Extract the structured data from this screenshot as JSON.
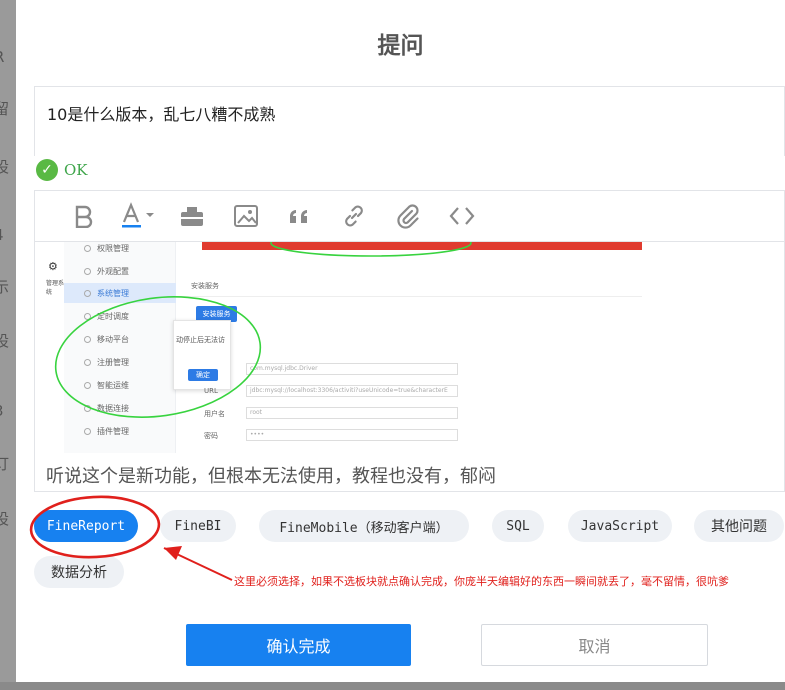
{
  "dialog": {
    "title": "提问",
    "question_text": "10是什么版本，乱七八糟不成熟",
    "ok_label": "OK",
    "toolbar": {
      "icons": [
        "bold-icon",
        "font-color-icon",
        "code-block-icon",
        "image-icon",
        "quote-icon",
        "link-icon",
        "attachment-icon",
        "code-icon"
      ]
    },
    "embedded_screenshot": {
      "sidebar_items": [
        "权限管理",
        "外观配置",
        "系统管理",
        "定时调度",
        "移动平台",
        "注册管理",
        "智能运维",
        "数据连接",
        "插件管理"
      ],
      "active_item": "系统管理",
      "system_label": "管理系统",
      "section_label": "安装服务",
      "install_button": "安装服务",
      "popup_text": "动停止后无法访",
      "popup_confirm": "确定",
      "driver_value": "com.mysql.jdbc.Driver",
      "url_label": "URL",
      "url_value": "jdbc:mysql://localhost:3306/activiti?useUnicode=true&characterE",
      "user_label": "用户名",
      "user_value": "root",
      "password_label": "密码",
      "password_value": "••••"
    },
    "body_text": "听说这个是新功能，但根本无法使用，教程也没有，郁闷",
    "tags": [
      "FineReport",
      "FineBI",
      "FineMobile（移动客户端）",
      "SQL",
      "JavaScript",
      "其他问题",
      "数据分析"
    ],
    "selected_tag": "FineReport",
    "annotation_text": "这里必须选择，如果不选板块就点确认完成，你庞半天编辑好的东西一瞬间就丢了，毫不留情，很吭爹",
    "confirm_label": "确认完成",
    "cancel_label": "取消"
  },
  "colors": {
    "accent": "#1781f0",
    "annotation_red": "#e0201c",
    "ok_green": "#59b944",
    "circle_green": "#38d33f"
  }
}
